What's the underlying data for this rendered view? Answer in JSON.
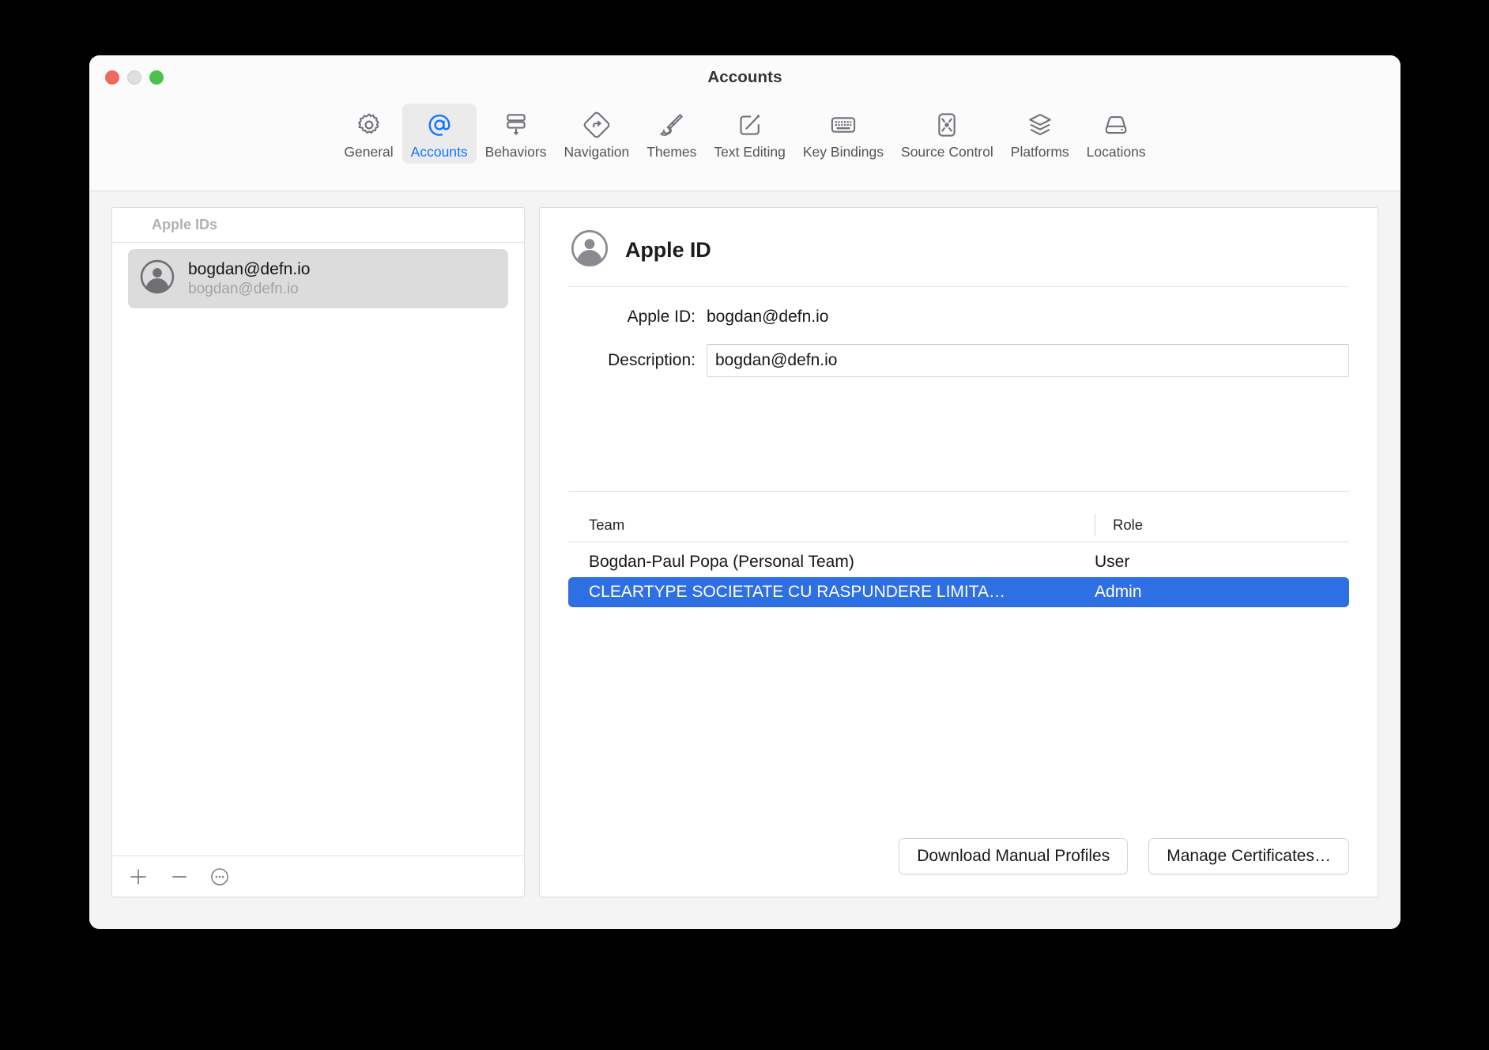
{
  "window": {
    "title": "Accounts",
    "traffic_lights": [
      "close-red",
      "minimize-gray",
      "zoom-green"
    ]
  },
  "toolbar": {
    "items": [
      {
        "label": "General",
        "icon": "gear-icon",
        "selected": false
      },
      {
        "label": "Accounts",
        "icon": "at-sign-icon",
        "selected": true
      },
      {
        "label": "Behaviors",
        "icon": "behaviors-icon",
        "selected": false
      },
      {
        "label": "Navigation",
        "icon": "navigation-icon",
        "selected": false
      },
      {
        "label": "Themes",
        "icon": "paintbrush-icon",
        "selected": false
      },
      {
        "label": "Text Editing",
        "icon": "pencil-square-icon",
        "selected": false
      },
      {
        "label": "Key Bindings",
        "icon": "keyboard-icon",
        "selected": false
      },
      {
        "label": "Source Control",
        "icon": "source-control-icon",
        "selected": false
      },
      {
        "label": "Platforms",
        "icon": "layers-icon",
        "selected": false
      },
      {
        "label": "Locations",
        "icon": "disk-icon",
        "selected": false
      }
    ]
  },
  "sidebar": {
    "header": "Apple IDs",
    "accounts": [
      {
        "primary": "bogdan@defn.io",
        "secondary": "bogdan@defn.io",
        "selected": true
      }
    ],
    "footer_buttons": [
      {
        "name": "add-account-button",
        "glyph": "+"
      },
      {
        "name": "remove-account-button",
        "glyph": "−"
      },
      {
        "name": "more-options-button",
        "glyph": "⋯"
      }
    ]
  },
  "detail": {
    "title": "Apple ID",
    "fields": {
      "apple_id_label": "Apple ID:",
      "apple_id_value": "bogdan@defn.io",
      "description_label": "Description:",
      "description_value": "bogdan@defn.io",
      "description_placeholder": "Description"
    },
    "table": {
      "columns": [
        "Team",
        "Role"
      ],
      "rows": [
        {
          "team": "Bogdan-Paul Popa (Personal Team)",
          "role": "User",
          "selected": false
        },
        {
          "team": "CLEARTYPE SOCIETATE CU RASPUNDERE LIMITA…",
          "role": "Admin",
          "selected": true
        }
      ]
    },
    "buttons": [
      {
        "label": "Download Manual Profiles",
        "name": "download-manual-profiles-button"
      },
      {
        "label": "Manage Certificates…",
        "name": "manage-certificates-button"
      }
    ]
  },
  "colors": {
    "accent": "#1473ff",
    "selection": "#2f6fe4",
    "window_bg": "#f4f4f4",
    "panel_bg": "#ffffff",
    "toolbar_bg": "#fbfbfb",
    "sidebar_selection": "#dcdcdc"
  }
}
